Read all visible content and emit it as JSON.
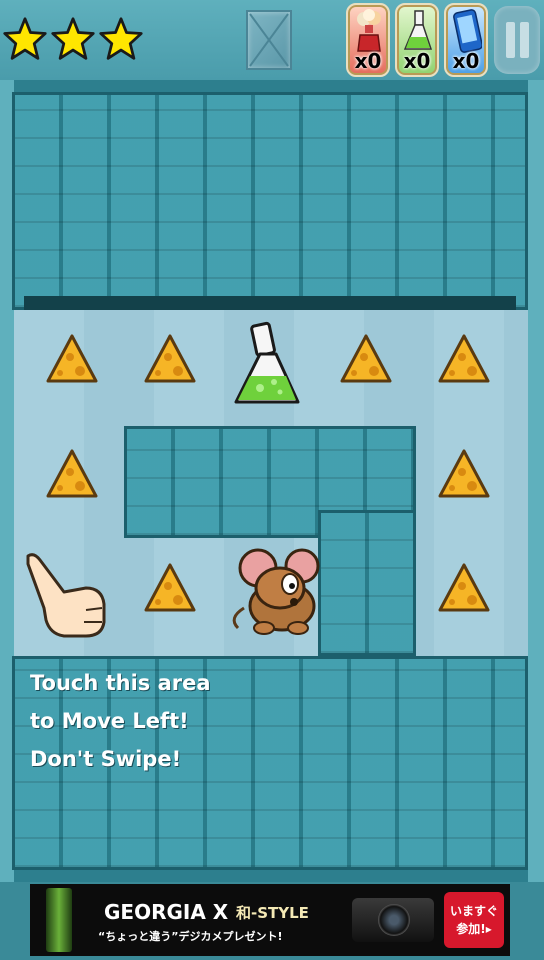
{
  "hud": {
    "stars": [
      {
        "icon": "star-icon",
        "filled": true
      },
      {
        "icon": "star-icon",
        "filled": true
      },
      {
        "icon": "star-icon",
        "filled": true
      }
    ],
    "menu_icon": "crossed-tile-icon",
    "powerups": [
      {
        "icon": "bomb-potion-icon",
        "count": "x0"
      },
      {
        "icon": "flask-icon",
        "count": "x0"
      },
      {
        "icon": "phone-icon",
        "count": "x0"
      }
    ],
    "pause_icon": "pause-icon"
  },
  "board": {
    "items": {
      "cheese_count": 8,
      "cheese_icon": "cheese-icon",
      "potion_icon": "green-flask-icon",
      "player_icon": "mouse-icon",
      "hint_icon": "pointing-hand-icon"
    }
  },
  "tutorial": {
    "line1": "Touch this area",
    "line2": "to Move Left!",
    "line3": "Don't Swipe!"
  },
  "ad": {
    "brand": "GEORGIA X",
    "style": "和-STYLE",
    "tagline": "“ちょっと違う”デジカメプレゼント!",
    "cta_line1": "いますぐ",
    "cta_line2": "参加!"
  },
  "colors": {
    "wall": "#2e8a9a",
    "floor": "#a7cfdd",
    "star": "#ffe600",
    "cheese": "#f6b526",
    "ad_cta": "#d7182c"
  }
}
